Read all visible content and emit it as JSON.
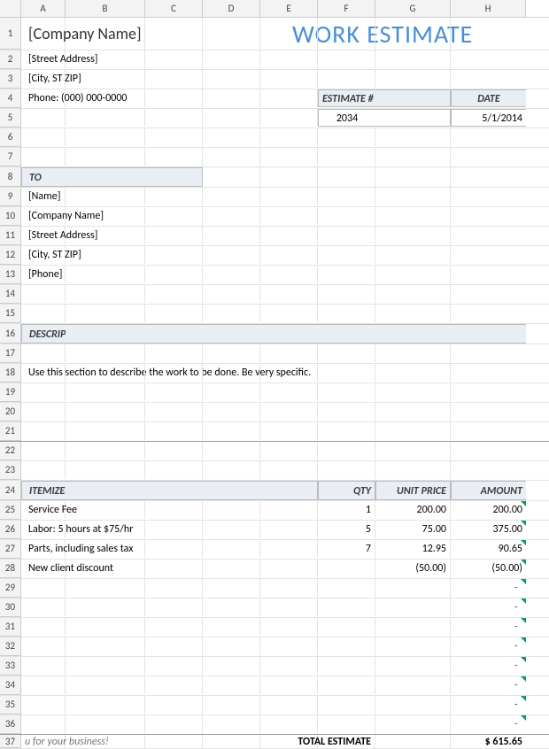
{
  "columns": [
    "A",
    "B",
    "C",
    "D",
    "E",
    "F",
    "G",
    "H"
  ],
  "rows": [
    "1",
    "2",
    "3",
    "4",
    "5",
    "6",
    "7",
    "8",
    "9",
    "10",
    "11",
    "12",
    "13",
    "14",
    "15",
    "16",
    "17",
    "18",
    "19",
    "20",
    "21",
    "22",
    "23",
    "24",
    "25",
    "26",
    "27",
    "28",
    "29",
    "30",
    "31",
    "32",
    "33",
    "34",
    "35",
    "36",
    "37"
  ],
  "header": {
    "company": "[Company Name]",
    "title": "WORK ESTIMATE",
    "street": "[Street Address]",
    "city": "[City, ST  ZIP]",
    "phone": "Phone: (000) 000-0000"
  },
  "est_header": {
    "estimate_label": "ESTIMATE #",
    "date_label": "DATE",
    "estimate_value": "2034",
    "date_value": "5/1/2014"
  },
  "to": {
    "label": "TO",
    "name": "[Name]",
    "company": "[Company Name]",
    "street": "[Street Address]",
    "city": "[City, ST  ZIP]",
    "phone": "[Phone]"
  },
  "desc": {
    "label": "DESCRIPTION OF WORK",
    "text": "Use this section to describe the work to be done. Be very specific."
  },
  "items": {
    "label": "ITEMIZED COSTS",
    "col_qty": "QTY",
    "col_unit": "UNIT PRICE",
    "col_amt": "AMOUNT",
    "rows": [
      {
        "desc": "Service Fee",
        "qty": "1",
        "unit": "200.00",
        "amt": "200.00"
      },
      {
        "desc": "Labor: 5 hours at $75/hr",
        "qty": "5",
        "unit": "75.00",
        "amt": "375.00"
      },
      {
        "desc": "Parts, including sales tax",
        "qty": "7",
        "unit": "12.95",
        "amt": "90.65"
      },
      {
        "desc": "New client discount",
        "qty": "",
        "unit": "(50.00)",
        "amt": "(50.00)"
      }
    ],
    "empty_amt": "-"
  },
  "footer": {
    "thanks": "u for your business!",
    "total_label": "TOTAL ESTIMATE",
    "total_value": "$   615.65"
  }
}
